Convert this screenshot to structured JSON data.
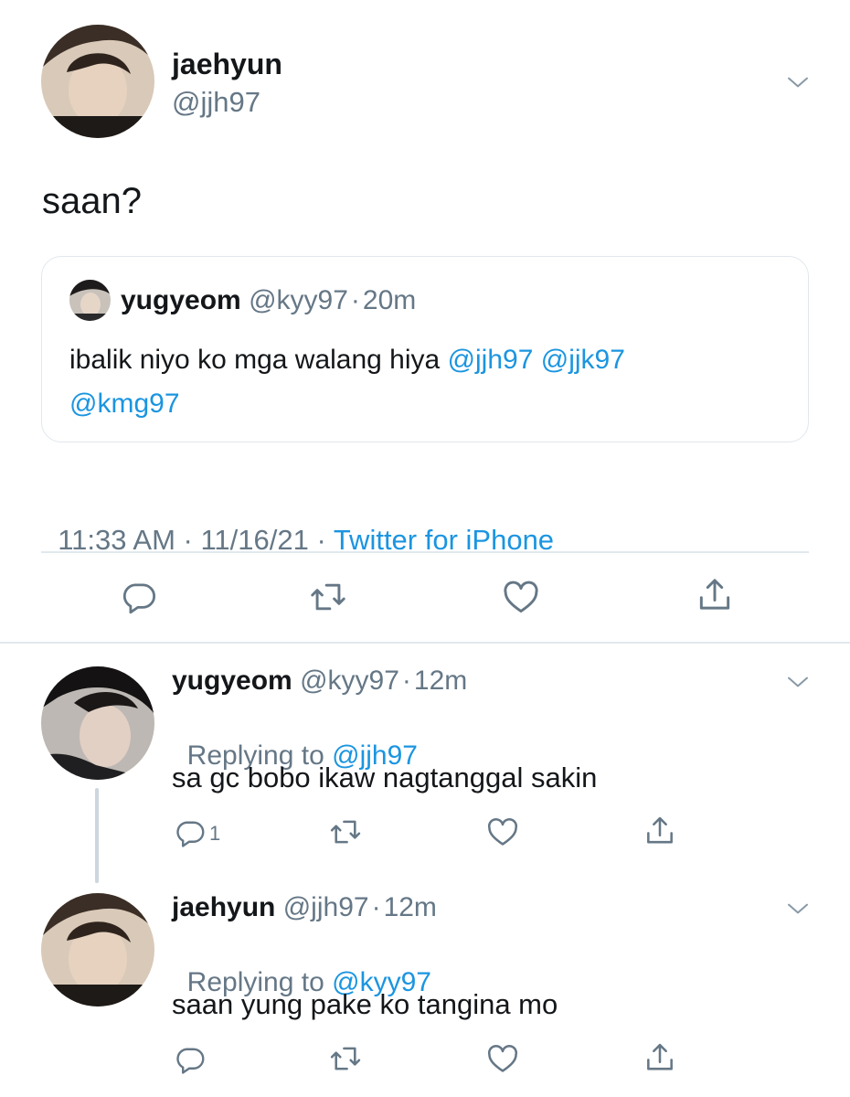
{
  "main_tweet": {
    "display_name": "jaehyun",
    "handle": "@jjh97",
    "text": "saan?",
    "quoted": {
      "display_name": "yugyeom",
      "handle": "@kyy97",
      "sep": "·",
      "time": "20m",
      "text_plain": "ibalik niyo ko mga walang hiya ",
      "mention1": "@jjh97",
      "mention2": "@jjk97",
      "mention3": "@kmg97"
    },
    "timestamp": "11:33 AM · 11/16/21 · ",
    "source": "Twitter for iPhone"
  },
  "replies": [
    {
      "display_name": "yugyeom",
      "handle": "@kyy97",
      "sep": "·",
      "time": "12m",
      "replying_label": "Replying to ",
      "replying_to": "@jjh97",
      "text": "sa gc bobo ikaw nagtanggal sakin",
      "reply_count": "1"
    },
    {
      "display_name": "jaehyun",
      "handle": "@jjh97",
      "sep": "·",
      "time": "12m",
      "replying_label": "Replying to ",
      "replying_to": "@kyy97",
      "text": "saan yung pake ko tangina mo",
      "reply_count": ""
    }
  ],
  "icons": [
    "chevron-down-icon",
    "reply-icon",
    "retweet-icon",
    "like-icon",
    "share-icon"
  ],
  "colors": {
    "link": "#1b95e0",
    "secondary": "#657786",
    "border": "#e1e8ed",
    "text": "#14171a"
  }
}
